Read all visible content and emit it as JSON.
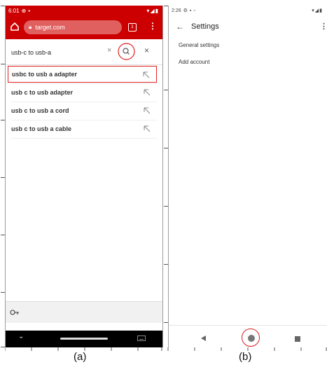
{
  "phone_a": {
    "status": {
      "time": "6:01"
    },
    "browser": {
      "url": "target.com",
      "tab_count": "1"
    },
    "search": {
      "query": "usb-c to usb-a"
    },
    "suggestions": [
      {
        "text": "usbc to usb a adapter",
        "highlighted": true
      },
      {
        "text": "usb c to usb adapter",
        "highlighted": false
      },
      {
        "text": "usb c to usb a cord",
        "highlighted": false
      },
      {
        "text": "usb c to usb a cable",
        "highlighted": false
      }
    ],
    "caption": "(a)"
  },
  "phone_b": {
    "status": {
      "time": "2:26"
    },
    "title": "Settings",
    "menu_items": [
      "General settings",
      "Add account"
    ],
    "caption": "(b)"
  },
  "colors": {
    "accent": "#cc0000",
    "highlight": "#e02020"
  }
}
